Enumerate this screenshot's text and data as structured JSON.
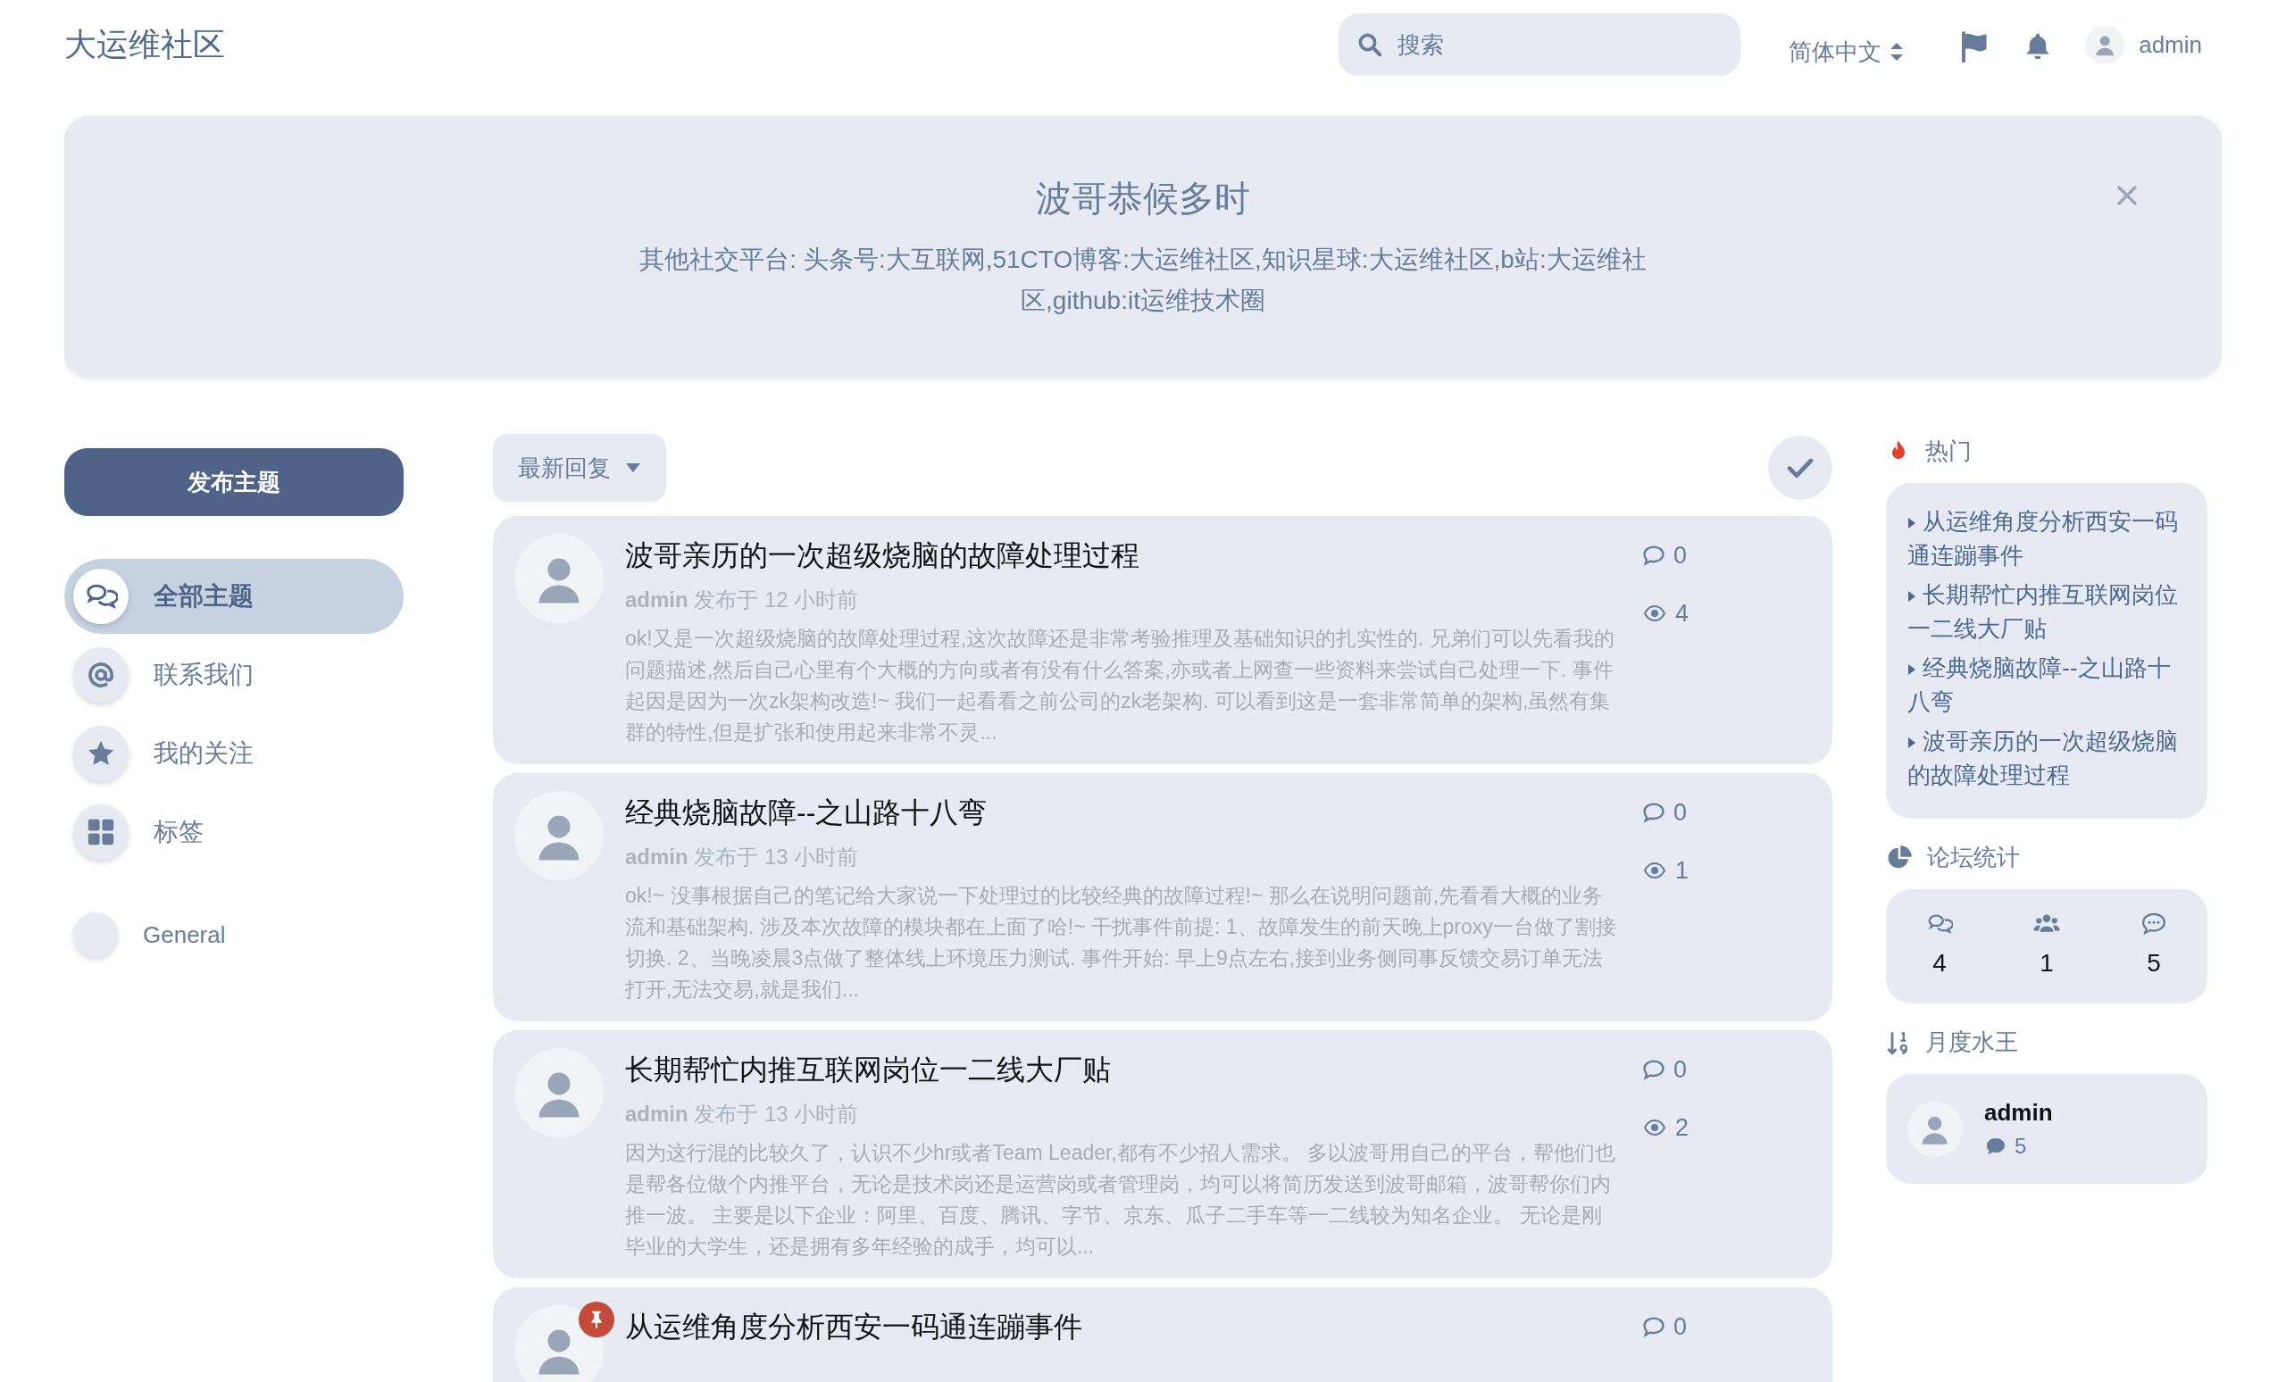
{
  "header": {
    "logo": "大运维社区",
    "search": {
      "placeholder": "搜索"
    },
    "language": "简体中文",
    "user": "admin"
  },
  "banner": {
    "title": "波哥恭候多时",
    "text": "其他社交平台: 头条号:大互联网,51CTO博客:大运维社区,知识星球:大运维社区,b站:大运维社区,github:it运维技术圈"
  },
  "sidebar": {
    "start_button": "发布主题",
    "nav": [
      {
        "label": "全部主题",
        "kind": "discussions",
        "selected": true
      },
      {
        "label": "联系我们",
        "kind": "at",
        "selected": false
      },
      {
        "label": "我的关注",
        "kind": "star",
        "selected": false
      },
      {
        "label": "标签",
        "kind": "grid",
        "selected": false
      }
    ],
    "tags": [
      {
        "label": "General"
      }
    ]
  },
  "toolbar": {
    "sort": "最新回复"
  },
  "topics": [
    {
      "title": "波哥亲历的一次超级烧脑的故障处理过程",
      "author": "admin",
      "time": "发布于 12 小时前",
      "excerpt": "ok!又是一次超级烧脑的故障处理过程,这次故障还是非常考验推理及基础知识的扎实性的. 兄弟们可以先看我的问题描述,然后自己心里有个大概的方向或者有没有什么答案,亦或者上网查一些资料来尝试自己处理一下. 事件起因是因为一次zk架构改造!~ 我们一起看看之前公司的zk老架构. 可以看到这是一套非常简单的架构,虽然有集群的特性,但是扩张和使用起来非常不灵...",
      "replies": "0",
      "views": "4",
      "pinned": false
    },
    {
      "title": "经典烧脑故障--之山路十八弯",
      "author": "admin",
      "time": "发布于 13 小时前",
      "excerpt": "ok!~ 没事根据自己的笔记给大家说一下处理过的比较经典的故障过程!~ 那么在说明问题前,先看看大概的业务流和基础架构. 涉及本次故障的模块都在上面了哈!~ 干扰事件前提: 1、故障发生的前天晚上proxy一台做了割接切换. 2、当晚凌晨3点做了整体线上环境压力测试. 事件开始: 早上9点左右,接到业务侧同事反馈交易订单无法打开,无法交易,就是我们...",
      "replies": "0",
      "views": "1",
      "pinned": false
    },
    {
      "title": "长期帮忙内推互联网岗位一二线大厂贴",
      "author": "admin",
      "time": "发布于 13 小时前",
      "excerpt": "因为这行混的比较久了，认识不少hr或者Team Leader,都有不少招人需求。 多以波哥用自己的平台，帮他们也是帮各位做个内推平台，无论是技术岗还是运营岗或者管理岗，均可以将简历发送到波哥邮箱，波哥帮你们内推一波。 主要是以下企业：阿里、百度、腾讯、字节、京东、瓜子二手车等一二线较为知名企业。 无论是刚毕业的大学生，还是拥有多年经验的成手，均可以...",
      "replies": "0",
      "views": "2",
      "pinned": false
    },
    {
      "title": "从运维角度分析西安一码通连蹦事件",
      "replies": "0",
      "pinned": true
    }
  ],
  "hot": {
    "title": "热门",
    "items": [
      "从运维角度分析西安一码通连蹦事件",
      "长期帮忙内推互联网岗位一二线大厂贴",
      "经典烧脑故障--之山路十八弯",
      "波哥亲历的一次超级烧脑的故障处理过程"
    ]
  },
  "stats": {
    "title": "论坛统计",
    "items": [
      {
        "kind": "discussions",
        "value": "4"
      },
      {
        "kind": "users",
        "value": "1"
      },
      {
        "kind": "posts",
        "value": "5"
      }
    ]
  },
  "top_poster": {
    "title": "月度水王",
    "user": "admin",
    "count": "5"
  }
}
